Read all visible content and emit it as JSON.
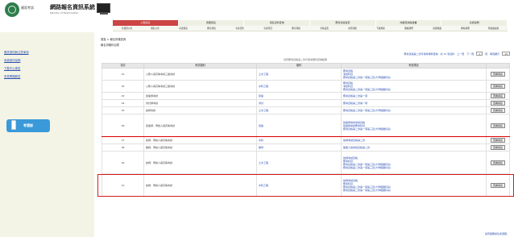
{
  "header": {
    "small_label": "國家考試",
    "title": "網路報名資訊系統",
    "subtitle": "Ministry of Examination"
  },
  "top_nav": [
    "公告訊息",
    "我要報名",
    "報名資料查詢",
    "應考資格審查",
    "成績查詢與證書",
    "系統說明"
  ],
  "top_nav_active": 0,
  "sub_nav": [
    "考選部公告",
    "報名公告",
    "考試資訊",
    "應考須知",
    "考試日程",
    "考試科目",
    "應考資格",
    "考區設置",
    "常見問題",
    "下載專區",
    "聯絡我們",
    "系統維護",
    "網站導覽",
    "隱私權政策"
  ],
  "left_nav": [
    "應試須知與注意事項",
    "系統操作說明",
    "下載中心專區",
    "常見問題解答"
  ],
  "promo": "考選部",
  "breadcrumb": "首頁 > 報名資格查詢",
  "breadcrumb2": "報名資格科目表",
  "pager": {
    "link1": "應考資格第二款可報考類科查詢",
    "count": "共 15 筆資料",
    "prev": "上一頁",
    "next": "下一頁",
    "page_value": "1",
    "page_label": "頁",
    "size_label": "每頁顯示",
    "size_value": "10"
  },
  "table_caption": "具有應考資格第二款可報考類科查詢結果",
  "columns": [
    "項次",
    "考試類科",
    "類科",
    "考選規定",
    ""
  ],
  "rows": [
    {
      "no": "01",
      "exam": "公務人員高等考試三級考試",
      "cat": "土木工程",
      "rules": [
        "應考資格",
        "考試科目",
        "應考資格第二款第一項第三目(大學相關科系)"
      ],
      "btn": "查看報名"
    },
    {
      "no": "02",
      "exam": "公務人員高等考試三級考試",
      "cat": "水利工程",
      "rules": [
        "應考資格",
        "考試科目",
        "應考資格第二款第一項第三目(大學相關科系)"
      ],
      "btn": "查看報名"
    },
    {
      "no": "03",
      "exam": "建築師考試",
      "cat": "建築",
      "rules": [
        "應考資格第二款第一項"
      ],
      "btn": "查看報名"
    },
    {
      "no": "04",
      "exam": "會計師考試",
      "cat": "會計",
      "rules": [
        "應考資格第二款第一項"
      ],
      "btn": "查看報名"
    },
    {
      "no": "05",
      "exam": "技師考試",
      "cat": "土木工程",
      "rules": [
        "應考資格第二款第一項第三目(大學相關科系)"
      ],
      "btn": "查看報名"
    },
    {
      "no": "06",
      "exam": "建築師、專技人員高等考試",
      "cat": "建築",
      "rules": [
        "建築師考試考試資格",
        "建築師考試應考科目",
        "應考資格第二款第一項第三目(大學相關科系)"
      ],
      "btn": "查看報名",
      "highlight": true
    },
    {
      "no": "07",
      "exam": "技師、專技人員高等考試",
      "cat": "水利",
      "rules": [
        "技師考試資格第二款"
      ],
      "btn": "查看報名"
    },
    {
      "no": "08",
      "exam": "醫師、專技人員高等考試",
      "cat": "醫學",
      "rules": [
        "醫事人員考試資格第二款"
      ],
      "btn": "查看報名"
    },
    {
      "no": "09",
      "exam": "技師、專技人員高等考試",
      "cat": "土木工程",
      "rules": [
        "技師考試資格",
        "應考科目",
        "應考資格第二款第一項第三目(大學相關科系)",
        "應考資格第二款第一項第三目(大學相關科系)"
      ],
      "btn": "查看報名"
    },
    {
      "no": "10",
      "exam": "技師、專技人員高等考試",
      "cat": "水利工程",
      "rules": [
        "技師考試資格",
        "應考科目",
        "應考資格第二款第一項第三目(大學相關科系)",
        "應考資格第二款第一項第三目(大學相關科系)"
      ],
      "btn": "查看報名"
    }
  ],
  "footnote": "如有疑義請洽考選部。"
}
